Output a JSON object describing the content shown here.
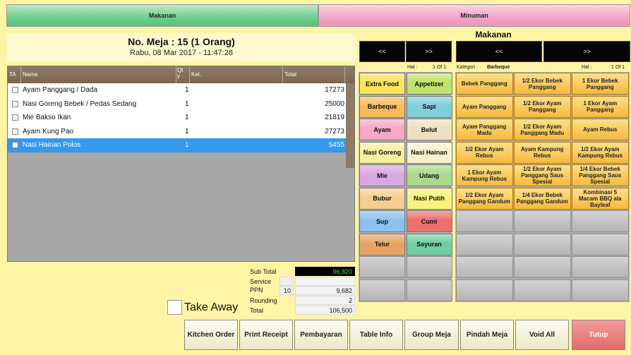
{
  "top_tabs": {
    "makanan": "Makanan",
    "minuman": "Minuman"
  },
  "header": {
    "title": "No. Meja : 15 (1 Orang)",
    "datetime": "Rabu, 08 Mar 2017 - 11:47:28"
  },
  "table": {
    "columns": {
      "ta": "TA",
      "nama": "Nama",
      "qty": "Qty",
      "ket": "Ket.",
      "total": "Total"
    },
    "rows": [
      {
        "nama": "Ayam Panggang / Dada",
        "qty": "1",
        "total": "17273"
      },
      {
        "nama": "Nasi Goreng Bebek / Pedas Sedang",
        "qty": "1",
        "total": "25000"
      },
      {
        "nama": "Mie Bakso Ikan",
        "qty": "1",
        "total": "21819"
      },
      {
        "nama": "Ayam Kung Pao",
        "qty": "1",
        "total": "27273"
      },
      {
        "nama": "Nasi Hainan Polos",
        "qty": "1",
        "total": "5455"
      }
    ]
  },
  "summary": {
    "subtotal_label": "Sub Total",
    "subtotal": "96,820",
    "service_label": "Service",
    "ppn_label": "PPN",
    "ppn_rate": "10",
    "ppn": "9,682",
    "rounding_label": "Rounding",
    "rounding": "2",
    "total_label": "Total",
    "total": "106,500"
  },
  "takeaway_label": "Take Away",
  "buttons": {
    "kitchen": "Kitchen Order",
    "print": "Print Receipt",
    "pembayaran": "Pembayaran",
    "tableinfo": "Table Info",
    "group": "Group Meja",
    "pindah": "Pindah Meja",
    "void": "Void All",
    "tutup": "Tutup"
  },
  "panel": {
    "title": "Makanan",
    "prev": "<<",
    "next": ">>",
    "cat_hal_label": "Hal :",
    "cat_hal": "1 Of 1",
    "kategori_label": "Kategori :",
    "kategori": "Barbeque",
    "prod_hal_label": "Hal :",
    "prod_hal": "1 Of 1"
  },
  "categories": [
    {
      "label": "Extra Food",
      "color": "#f9e45a"
    },
    {
      "label": "Appetizer",
      "color": "#bfe36a"
    },
    {
      "label": "Barbeque",
      "color": "#f6bb5a"
    },
    {
      "label": "Sapi",
      "color": "#7fcfd8"
    },
    {
      "label": "Ayam",
      "color": "#f5a9c4"
    },
    {
      "label": "Belut",
      "color": "#ece2c2"
    },
    {
      "label": "Nasi Goreng",
      "color": "#f7ef9e"
    },
    {
      "label": "Nasi Hainan",
      "color": "#f6f1cc"
    },
    {
      "label": "Mie",
      "color": "#d9a8e0"
    },
    {
      "label": "Udang",
      "color": "#a9d98a"
    },
    {
      "label": "Bubur",
      "color": "#f5cf8f"
    },
    {
      "label": "Nasi Putih",
      "color": "#f7f27c"
    },
    {
      "label": "Sup",
      "color": "#8cc0ee"
    },
    {
      "label": "Cumi",
      "color": "#ec6f6f"
    },
    {
      "label": "Telur",
      "color": "#e8a364"
    },
    {
      "label": "Sayuran",
      "color": "#70cfa0"
    }
  ],
  "products": [
    "Bebek Panggang",
    "1/2 Ekor Bebek Panggang",
    "1 Ekor Bebek Panggang",
    "Ayam Panggang",
    "1/2 Ekor Ayam Panggang",
    "1 Ekor Ayam Panggang",
    "Ayam Panggang Madu",
    "1/2 Ekor Ayam Panggang Madu",
    "Ayam Rebus",
    "1/2 Ekor Ayam Rebus",
    "Ayam Kampung Rebus",
    "1/2 Ekor Ayam Kampung Rebus",
    "1 Ekor Ayam Kampung Rebus",
    "1/2 Ekor Ayam Panggang Saus Spesial",
    "1/4 Ekor Bebek Panggang Saus Spesial",
    "1/2 Ekor Ayam Panggang Gandum",
    "1/4 Ekor Bebek Panggang Gandum",
    "Kombinasi 5 Macam BBQ ala Bayleaf"
  ]
}
